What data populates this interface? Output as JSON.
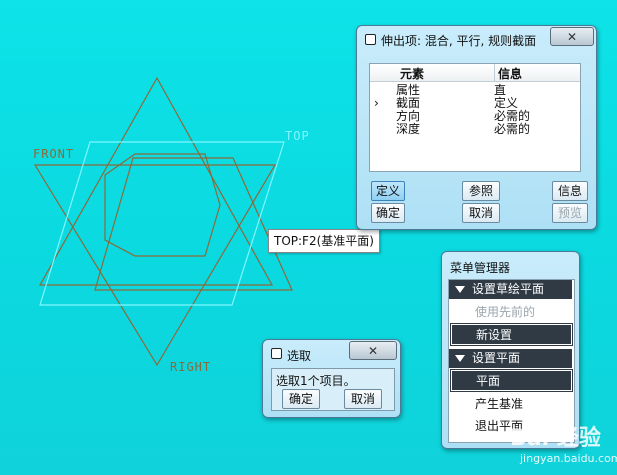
{
  "viewport": {
    "plane_labels": {
      "front": "FRONT",
      "top": "TOP",
      "right": "RIGHT"
    },
    "colors": {
      "datum_plane": "#8a6a3a",
      "highlight_plane": "#7ff7ff"
    }
  },
  "tooltip": {
    "text": "TOP:F2(基准平面)"
  },
  "feature_dialog": {
    "title": "伸出项: 混合, 平行, 规则截面",
    "close_label": "✕",
    "columns": {
      "element": "元素",
      "info": "信息"
    },
    "rows": [
      {
        "marker": "",
        "element": "属性",
        "info": "直"
      },
      {
        "marker": "›",
        "element": "截面",
        "info": "定义"
      },
      {
        "marker": "",
        "element": "方向",
        "info": "必需的"
      },
      {
        "marker": "",
        "element": "深度",
        "info": "必需的"
      }
    ],
    "buttons": {
      "define": "定义",
      "refs": "参照",
      "info": "信息",
      "ok": "确定",
      "cancel": "取消",
      "preview": "预览"
    }
  },
  "select_dialog": {
    "title": "选取",
    "close_label": "✕",
    "message": "选取1个项目。",
    "ok": "确定",
    "cancel": "取消"
  },
  "menu_manager": {
    "title": "菜单管理器",
    "section1": "设置草绘平面",
    "section1_items": {
      "use_previous": "使用先前的",
      "new_setting": "新设置"
    },
    "section2": "设置平面",
    "section2_items": {
      "plane": "平面",
      "create_datum": "产生基准",
      "exit_plane": "退出平面"
    }
  },
  "watermark": {
    "text": "Bai 经验",
    "url": "jingyan.baidu.com"
  }
}
